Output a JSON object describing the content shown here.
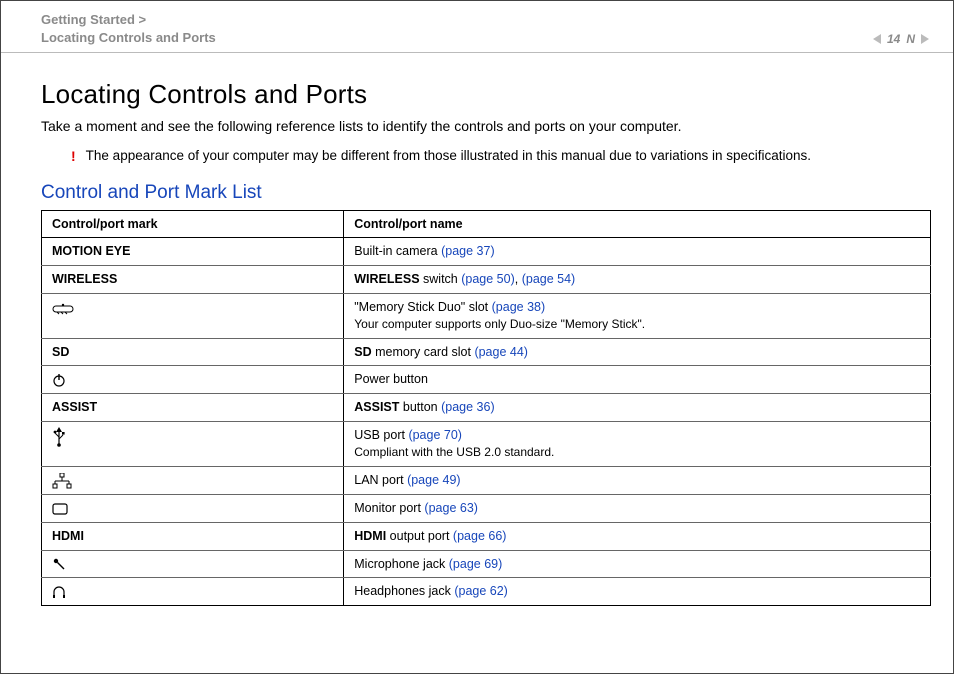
{
  "header": {
    "crumb1": "Getting Started >",
    "crumb2": "Locating Controls and Ports",
    "page": "14",
    "n_label": "N"
  },
  "title": "Locating Controls and Ports",
  "intro": "Take a moment and see the following reference lists to identify the controls and ports on your computer.",
  "note_bang": "!",
  "note_text": "The appearance of your computer may be different from those illustrated in this manual due to variations in specifications.",
  "subhead": "Control and Port Mark List",
  "table": {
    "head_mark": "Control/port mark",
    "head_name": "Control/port name",
    "rows": {
      "motioneye": {
        "mark": "MOTION EYE",
        "pre": "Built-in camera ",
        "link1": "(page 37)"
      },
      "wireless": {
        "mark": "WIRELESS",
        "pre_b": "WIRELESS",
        "pre": " switch ",
        "link1": "(page 50)",
        "sep": ", ",
        "link2": "(page 54)"
      },
      "ms": {
        "pre": "\"Memory Stick Duo\" slot ",
        "link1": "(page 38)",
        "sub": "Your computer supports only Duo-size \"Memory Stick\"."
      },
      "sd": {
        "mark": "SD",
        "pre_b": "SD",
        "pre": " memory card slot ",
        "link1": "(page 44)"
      },
      "power": {
        "pre": "Power button"
      },
      "assist": {
        "mark": "ASSIST",
        "pre_b": "ASSIST",
        "pre": " button ",
        "link1": "(page 36)"
      },
      "usb": {
        "pre": "USB port ",
        "link1": "(page 70)",
        "sub": "Compliant with the USB 2.0 standard."
      },
      "lan": {
        "pre": "LAN port ",
        "link1": "(page 49)"
      },
      "monitor": {
        "pre": "Monitor port ",
        "link1": "(page 63)"
      },
      "hdmi": {
        "mark": "HDMI",
        "pre_b": "HDMI",
        "pre": " output port ",
        "link1": "(page 66)"
      },
      "mic": {
        "pre": "Microphone jack ",
        "link1": "(page 69)"
      },
      "hp": {
        "pre": "Headphones jack ",
        "link1": "(page 62)"
      }
    }
  }
}
